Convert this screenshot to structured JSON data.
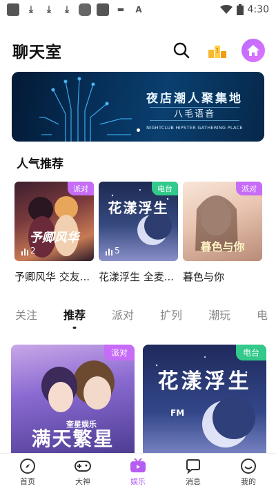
{
  "status_bar": {
    "time": "4:30"
  },
  "header": {
    "title": "聊天室"
  },
  "banner": {
    "title": "夜店潮人聚集地",
    "subtitle": "八毛语音",
    "english": "NIGHTCLUB HIPSTER GATHERING PLACE"
  },
  "section": {
    "title": "人气推荐"
  },
  "popular": [
    {
      "name": "予卿风华 交友...",
      "tag": "派对",
      "count": "2",
      "art": "予卿风华"
    },
    {
      "name": "花漾浮生 全麦...",
      "tag": "电台",
      "count": "5",
      "art": "花漾浮生"
    },
    {
      "name": "暮色与你",
      "tag": "派对",
      "count": "",
      "art": "暮色与你"
    }
  ],
  "tabs": [
    "关注",
    "推荐",
    "派对",
    "扩列",
    "潮玩",
    "电"
  ],
  "active_tab": "推荐",
  "rooms": [
    {
      "tag": "派对",
      "art": "满天繁星",
      "art_sub": "奎星娱乐"
    },
    {
      "tag": "电台",
      "art": "花漾浮生",
      "art_sub": "FM"
    }
  ],
  "nav": [
    {
      "label": "首页",
      "icon": "compass-icon"
    },
    {
      "label": "大神",
      "icon": "gamepad-icon"
    },
    {
      "label": "娱乐",
      "icon": "tv-icon"
    },
    {
      "label": "消息",
      "icon": "chat-icon"
    },
    {
      "label": "我的",
      "icon": "smiley-icon"
    }
  ],
  "colors": {
    "accent": "#b55df2",
    "party_tag": "#c66cf7",
    "radio_tag": "#32c98a"
  }
}
